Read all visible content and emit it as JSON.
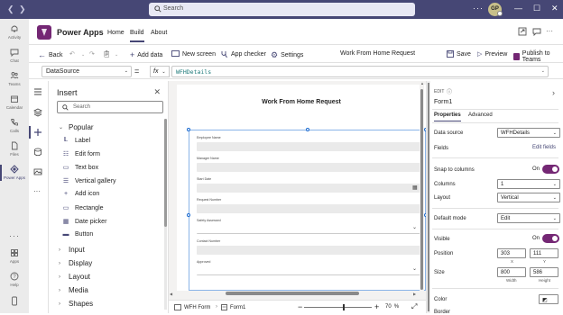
{
  "titlebar": {
    "search_placeholder": "Search",
    "avatar_initials": "GP"
  },
  "rail": [
    {
      "label": "Activity"
    },
    {
      "label": "Chat"
    },
    {
      "label": "Teams"
    },
    {
      "label": "Calendar"
    },
    {
      "label": "Calls"
    },
    {
      "label": "Files"
    },
    {
      "label": "Power Apps"
    },
    {
      "label": "Apps"
    },
    {
      "label": "Help"
    }
  ],
  "header": {
    "app_name": "Power Apps",
    "nav": [
      "Home",
      "Build",
      "About"
    ]
  },
  "commands": {
    "back": "Back",
    "add_data": "Add data",
    "new_screen": "New screen",
    "app_checker": "App checker",
    "settings": "Settings",
    "app_title": "Work From Home Request",
    "save": "Save",
    "preview": "Preview",
    "publish": "Publish to Teams"
  },
  "formula": {
    "property": "DataSource",
    "fx": "fx",
    "equals": "=",
    "value": "WFHDetails"
  },
  "insert": {
    "title": "Insert",
    "search_placeholder": "Search",
    "popular": "Popular",
    "items": [
      "Label",
      "Edit form",
      "Text box",
      "Vertical gallery",
      "Add icon",
      "Rectangle",
      "Date picker",
      "Button"
    ],
    "groups": [
      "Input",
      "Display",
      "Layout",
      "Media",
      "Shapes"
    ]
  },
  "canvas": {
    "form_title": "Work From Home Request",
    "fields": [
      {
        "label": "Employee Name"
      },
      {
        "label": "Manager Name"
      },
      {
        "label": "Start Date"
      },
      {
        "label": "Request Number"
      },
      {
        "label": "Safety Assessed"
      },
      {
        "label": "Contact Number"
      },
      {
        "label": "Approved"
      }
    ]
  },
  "statusbar": {
    "screen": "WFH Form",
    "control": "Form1",
    "zoom": "70",
    "zoom_unit": "%"
  },
  "props": {
    "edit_label": "EDIT",
    "control_name": "Form1",
    "tabs": [
      "Properties",
      "Advanced"
    ],
    "data_source_label": "Data source",
    "data_source_value": "WFHDetails",
    "fields_label": "Fields",
    "edit_fields": "Edit fields",
    "snap_label": "Snap to columns",
    "snap_value": "On",
    "columns_label": "Columns",
    "columns_value": "1",
    "layout_label": "Layout",
    "layout_value": "Vertical",
    "default_mode_label": "Default mode",
    "default_mode_value": "Edit",
    "visible_label": "Visible",
    "visible_value": "On",
    "position_label": "Position",
    "pos_x": "303",
    "pos_y": "111",
    "x_cap": "X",
    "y_cap": "Y",
    "size_label": "Size",
    "width": "800",
    "height": "586",
    "width_cap": "Width",
    "height_cap": "Height",
    "color_label": "Color",
    "border_label": "Border"
  }
}
